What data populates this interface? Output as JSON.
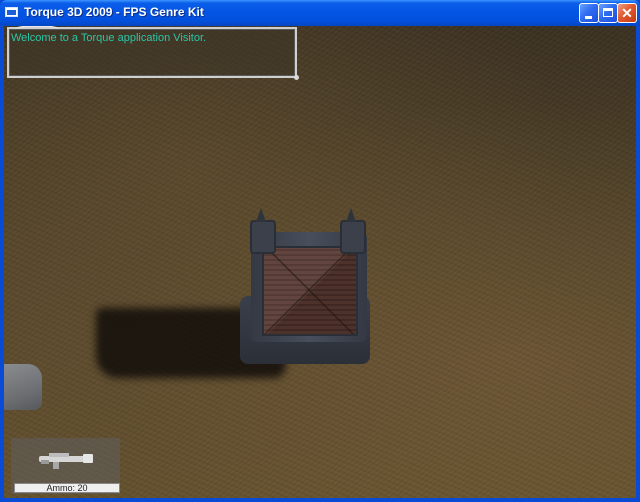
{
  "window": {
    "title": "Torque 3D 2009 - FPS Genre Kit",
    "controls": {
      "close_glyph": "✕"
    }
  },
  "hud": {
    "chat": {
      "message": "Welcome to a Torque application Visitor."
    },
    "weapon": {
      "icon": "rocket-launcher-icon",
      "ammo_label": "Ammo: 20"
    }
  },
  "colors": {
    "titlebar": "#0454e3",
    "chat_text": "#2bc6a7",
    "ground": "#5d4b2f"
  }
}
